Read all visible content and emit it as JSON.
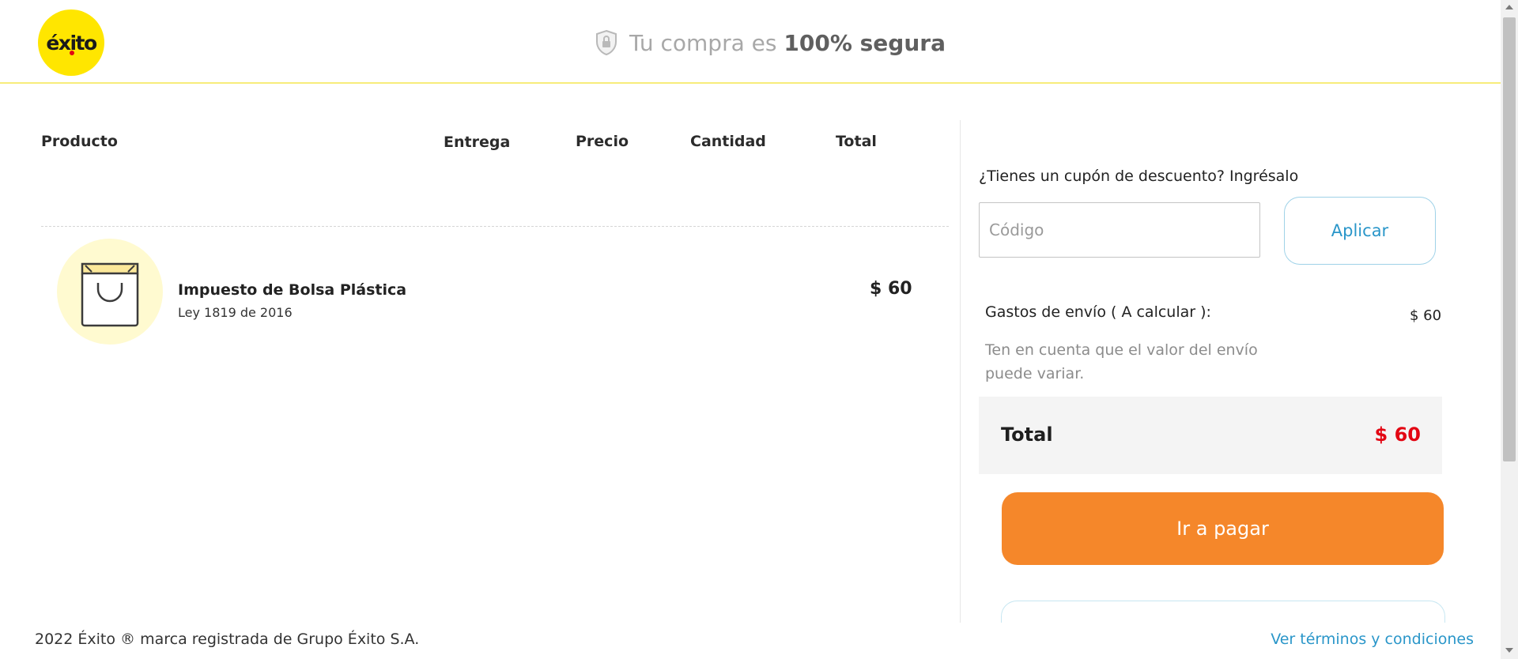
{
  "header": {
    "logo_text": "éxito",
    "secure_prefix": "Tu compra es",
    "secure_strong": "100% segura"
  },
  "table": {
    "columns": [
      "Producto",
      "Entrega",
      "Precio",
      "Cantidad",
      "Total"
    ],
    "rows": [
      {
        "name": "Impuesto de Bolsa Plástica",
        "subtitle": "Ley 1819 de 2016",
        "total": "$ 60",
        "icon": "shopping-bag-icon"
      }
    ]
  },
  "summary": {
    "coupon_label": "¿Tienes un cupón de descuento? Ingrésalo",
    "coupon_placeholder": "Código",
    "coupon_value": "",
    "apply_label": "Aplicar",
    "shipping_label": "Gastos de envío ( A calcular ):",
    "shipping_value": "$ 60",
    "shipping_note": "Ten en cuenta que el valor del envío puede variar.",
    "total_label": "Total",
    "total_value": "$ 60",
    "pay_label": "Ir a pagar"
  },
  "footer": {
    "copyright": "2022 Éxito ® marca registrada de Grupo Éxito S.A.",
    "terms_link": "Ver términos y condiciones"
  },
  "colors": {
    "brand_yellow": "#ffe600",
    "pay_orange": "#f5872a",
    "total_red": "#e30613",
    "link_blue": "#2a96c9"
  }
}
